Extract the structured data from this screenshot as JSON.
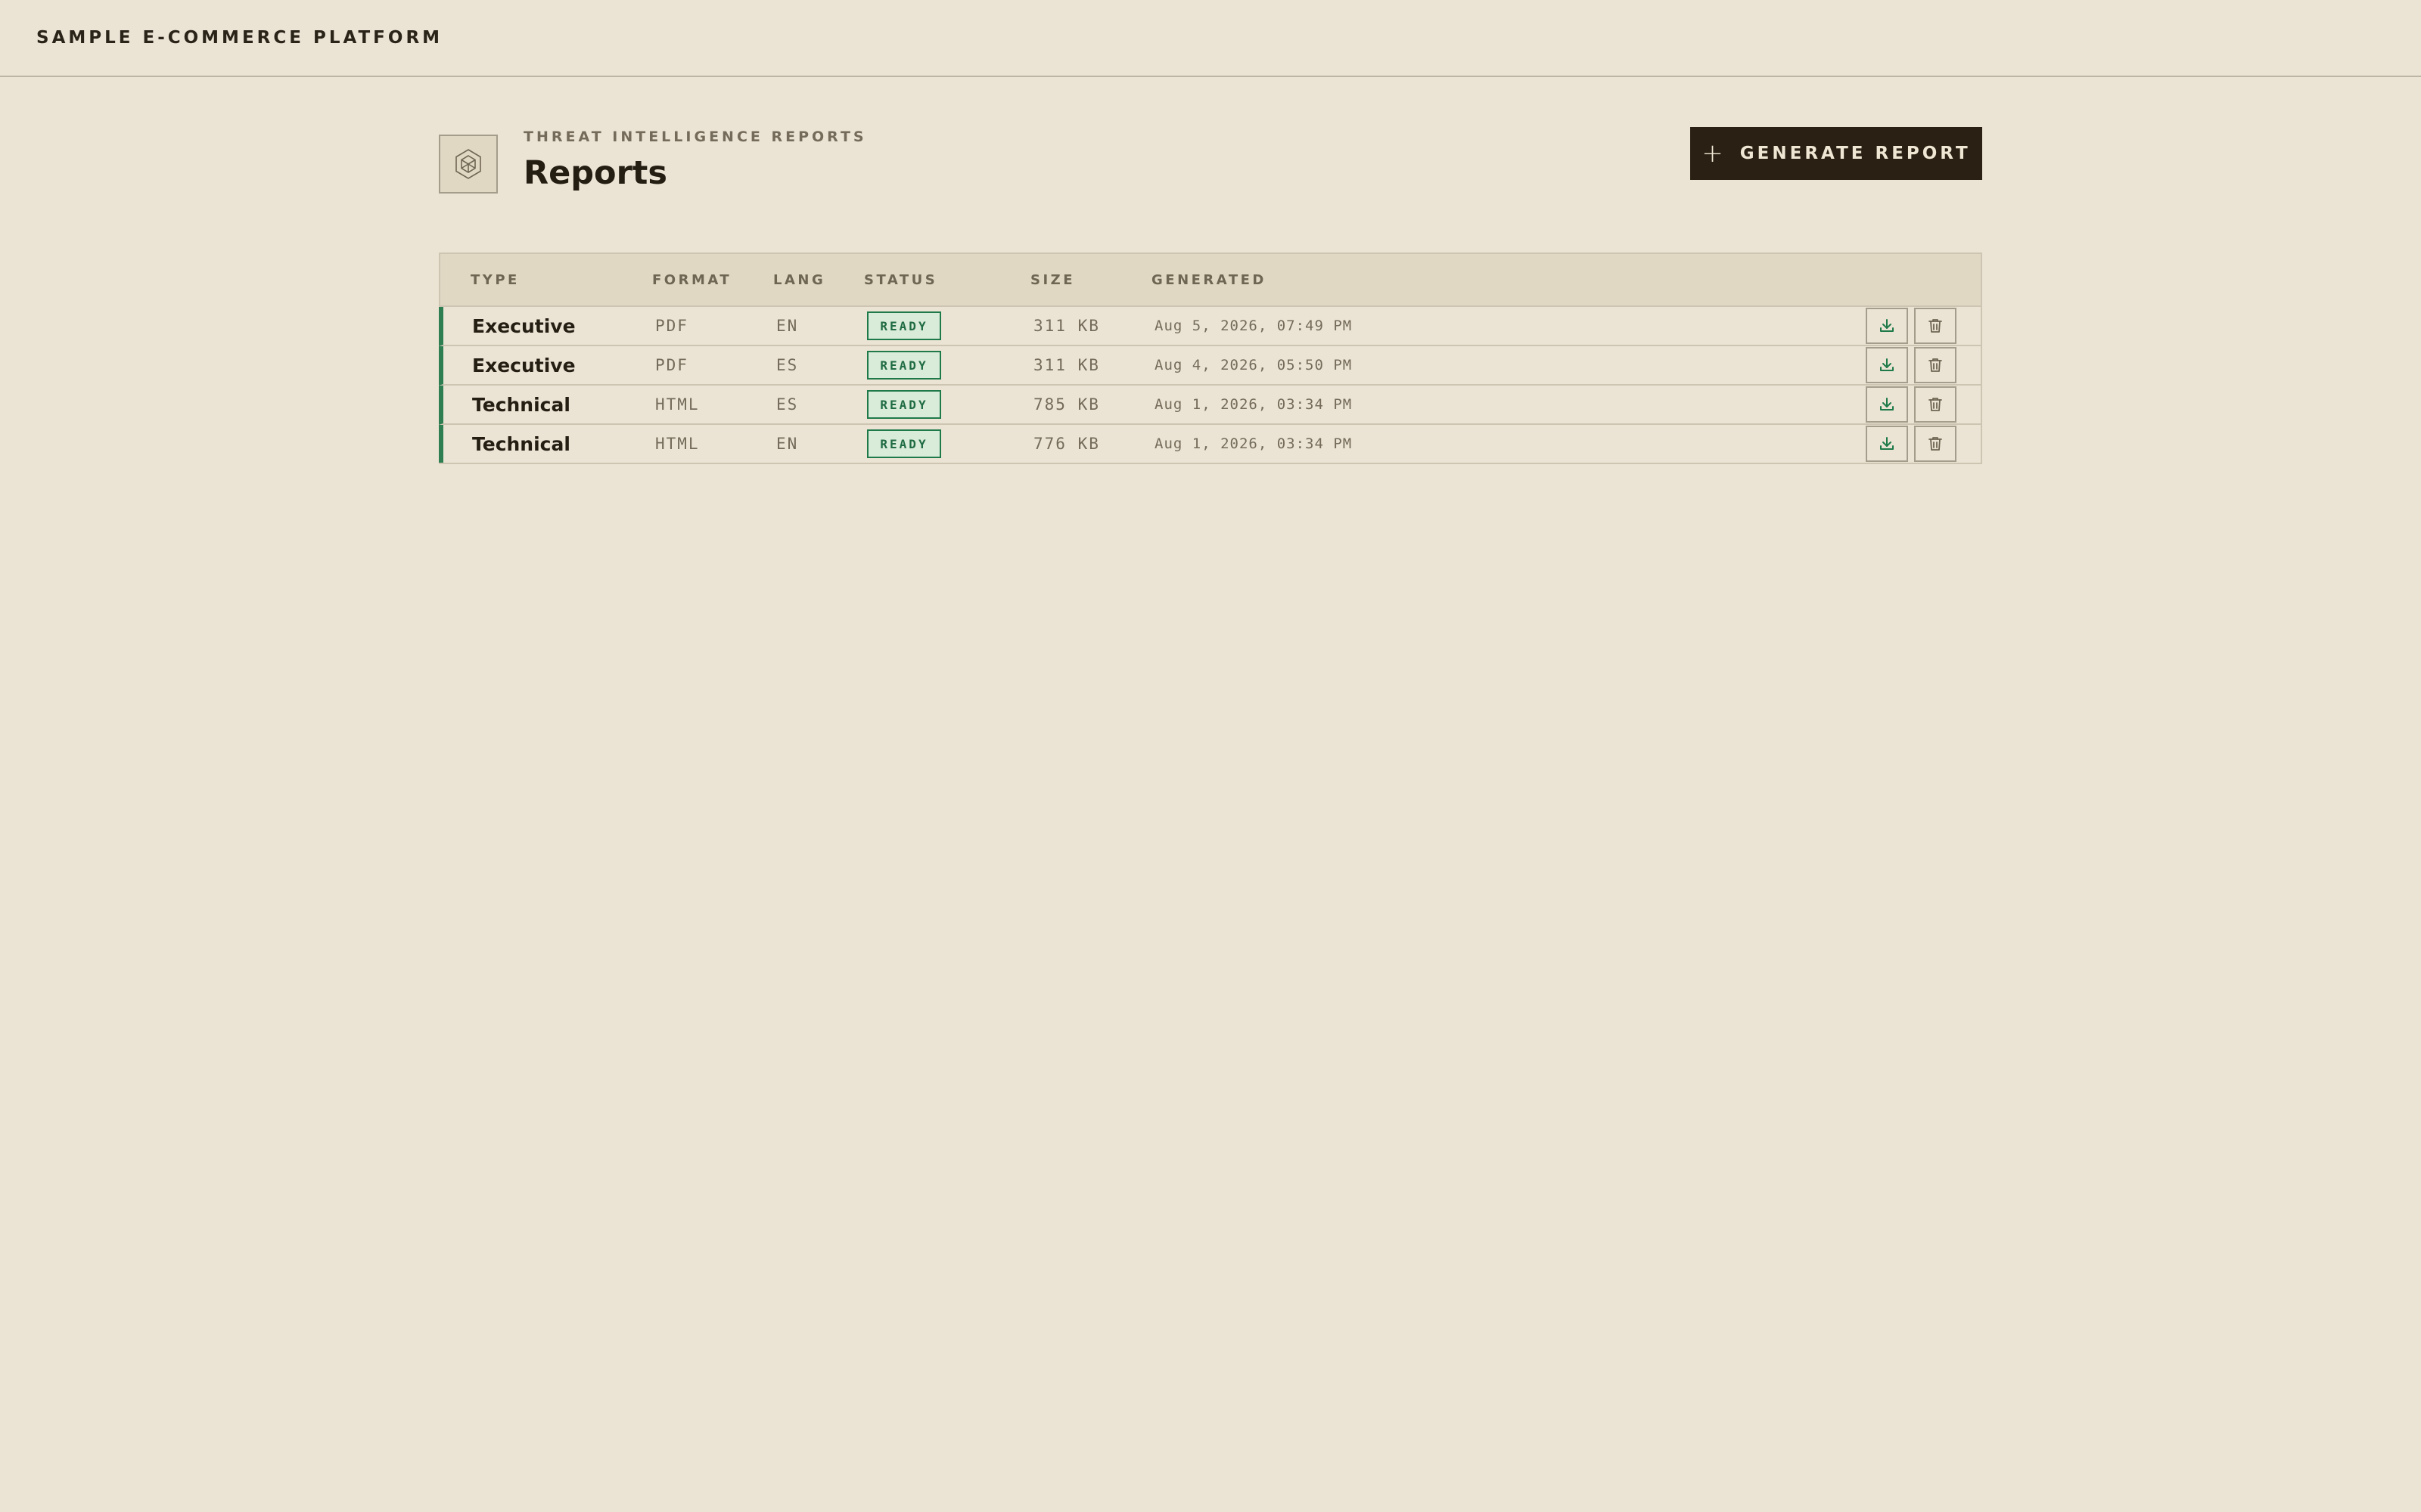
{
  "brand": "SAMPLE E-COMMERCE PLATFORM",
  "header": {
    "eyebrow": "THREAT INTELLIGENCE REPORTS",
    "title": "Reports",
    "generate_label": "GENERATE REPORT"
  },
  "table": {
    "columns": [
      "TYPE",
      "FORMAT",
      "LANG",
      "STATUS",
      "SIZE",
      "GENERATED"
    ],
    "rows": [
      {
        "type": "Executive",
        "format": "PDF",
        "lang": "EN",
        "status": "READY",
        "size": "311 KB",
        "generated": "Aug 5, 2026, 07:49 PM"
      },
      {
        "type": "Executive",
        "format": "PDF",
        "lang": "ES",
        "status": "READY",
        "size": "311 KB",
        "generated": "Aug 4, 2026, 05:50 PM"
      },
      {
        "type": "Technical",
        "format": "HTML",
        "lang": "ES",
        "status": "READY",
        "size": "785 KB",
        "generated": "Aug 1, 2026, 03:34 PM"
      },
      {
        "type": "Technical",
        "format": "HTML",
        "lang": "EN",
        "status": "READY",
        "size": "776 KB",
        "generated": "Aug 1, 2026, 03:34 PM"
      }
    ]
  },
  "icons": {
    "logo": "hexagon-cube-icon",
    "generate": "plus-icon",
    "download": "download-icon",
    "delete": "trash-icon"
  },
  "colors": {
    "background": "#ebe4d5",
    "primary_button": "#2a2114",
    "ready_accent": "#1f7a4a"
  }
}
